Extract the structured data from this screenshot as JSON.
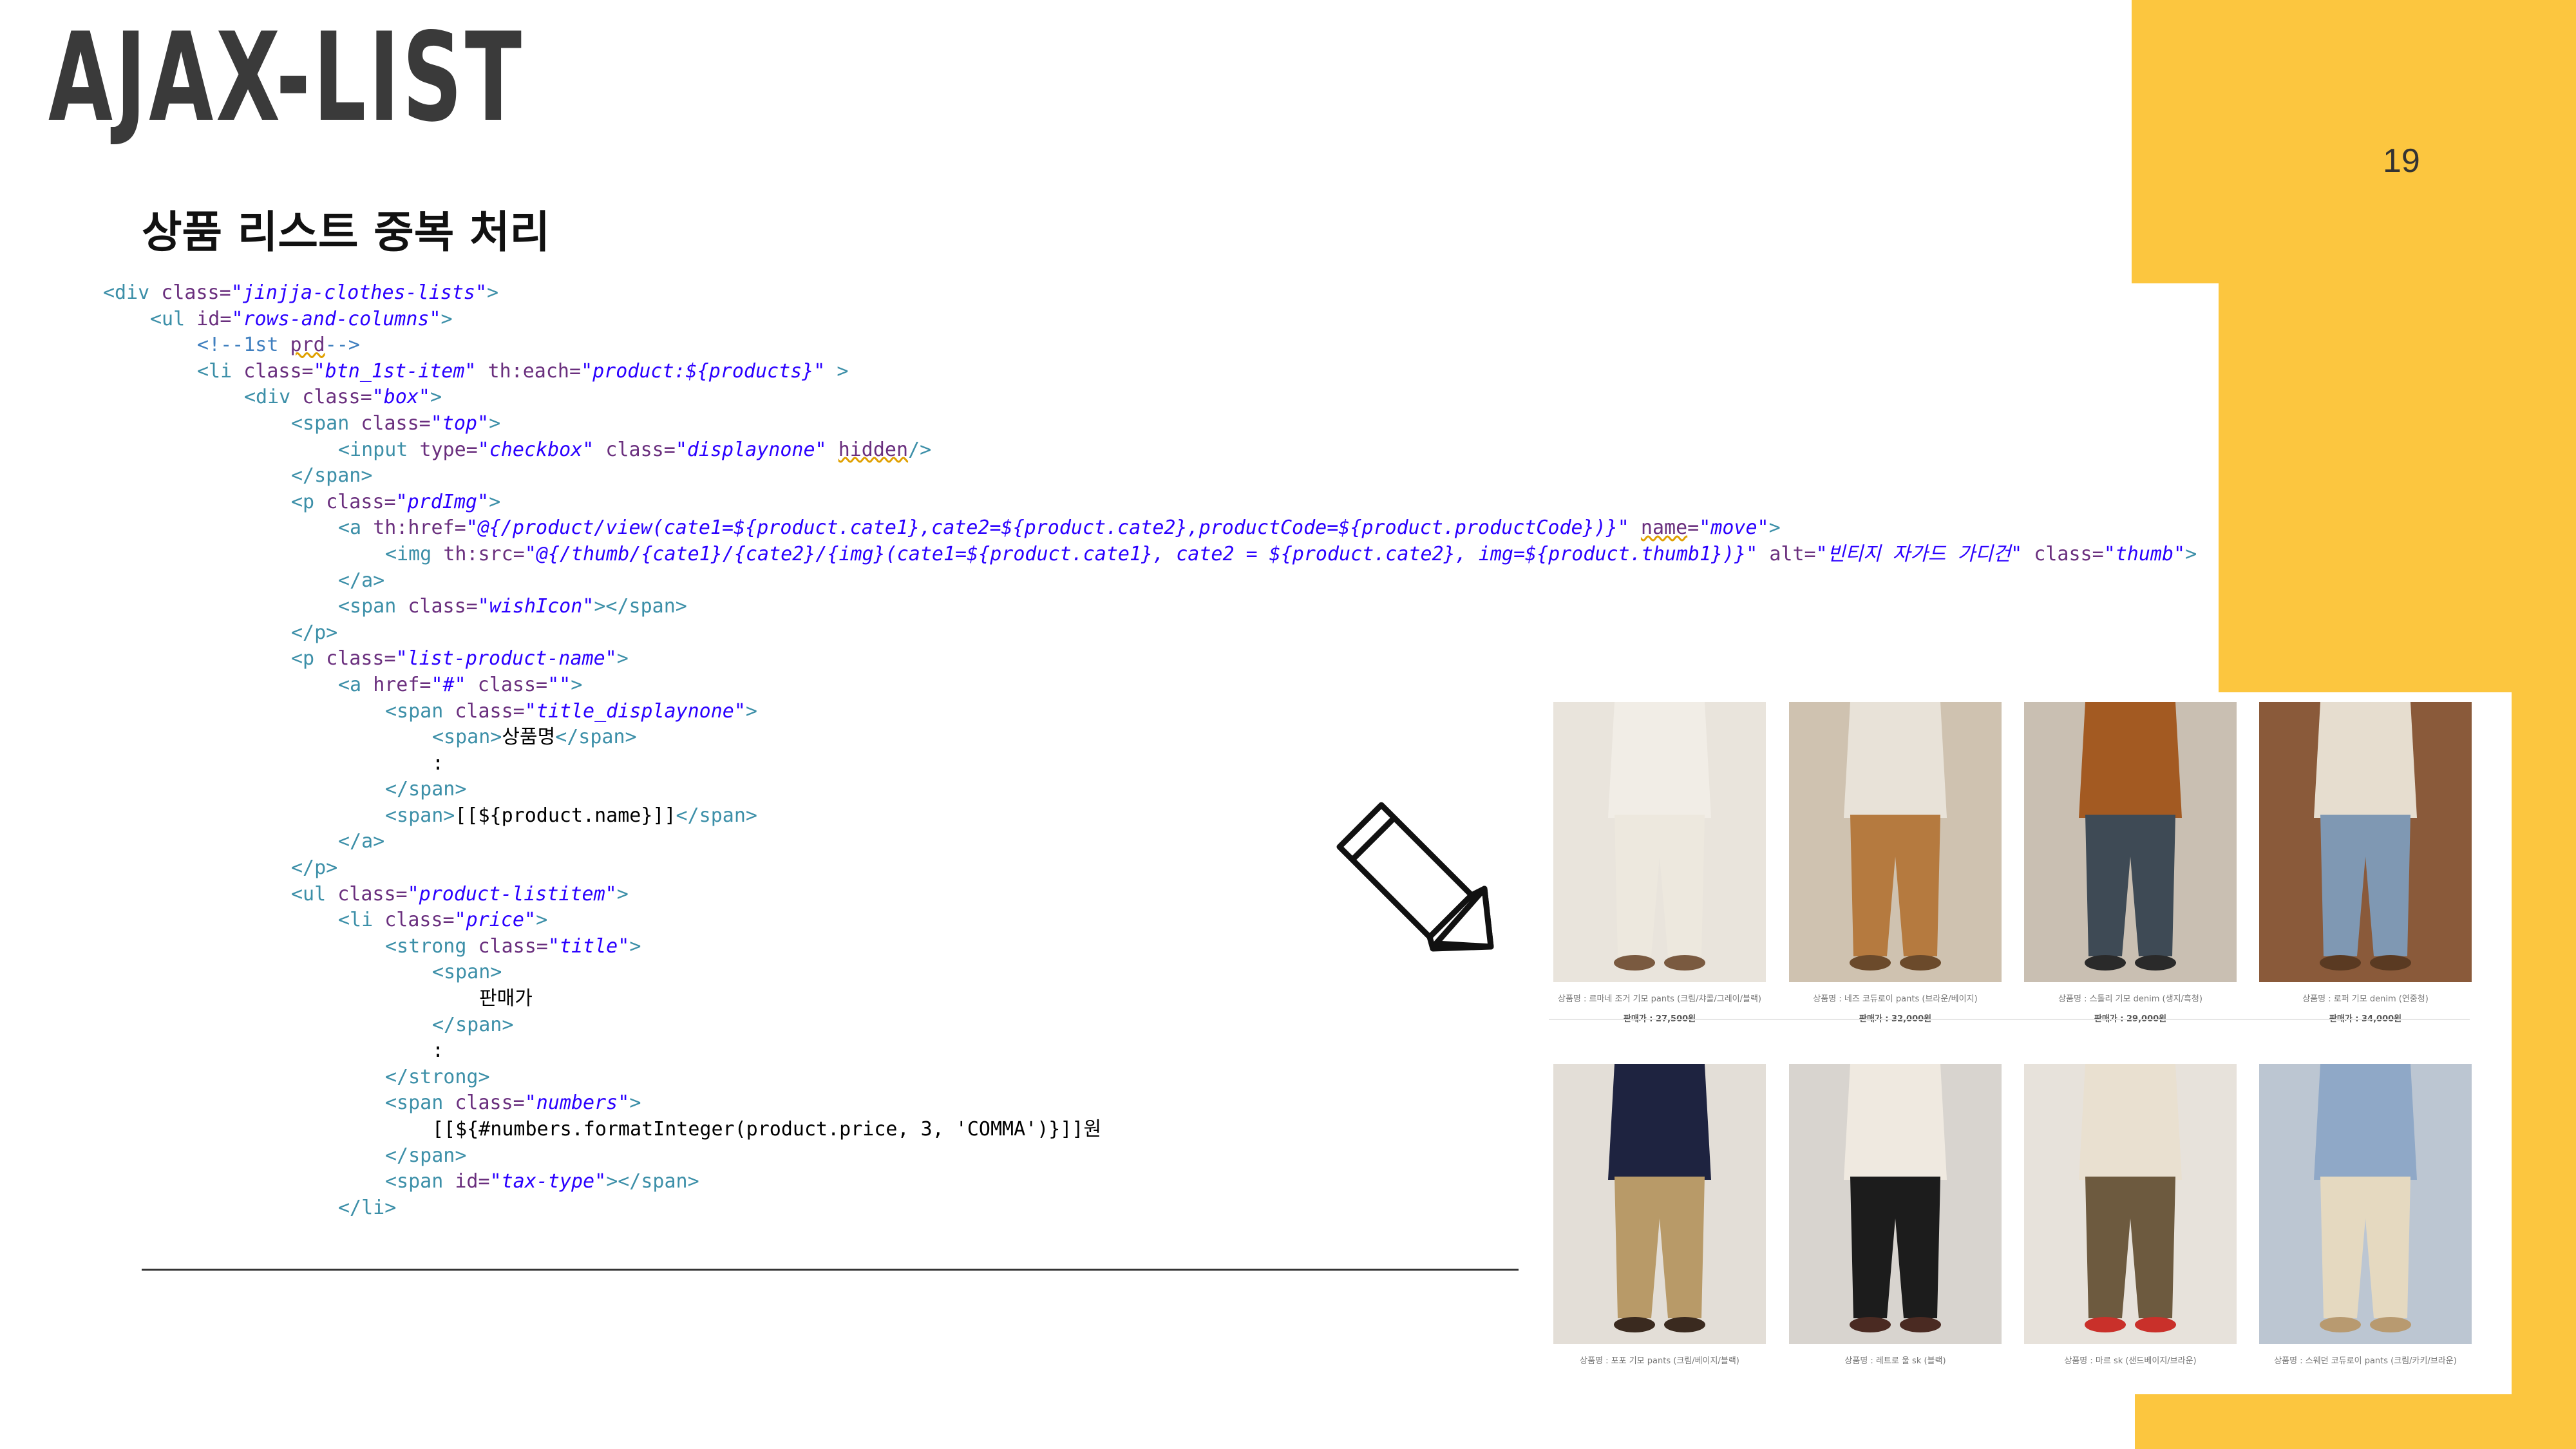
{
  "slide": {
    "title": "AJAX-LIST",
    "page_number": "19",
    "heading": "상품 리스트 중복 처리"
  },
  "colors": {
    "accent": "#fcc63f",
    "title": "#3a3a3a",
    "code_tag": "#3c8fa8",
    "code_attr": "#6a2f7e",
    "code_value": "#2a00ff"
  },
  "code_lines": [
    {
      "indent": 0,
      "tokens": [
        [
          "t",
          "<div "
        ],
        [
          "a",
          "class="
        ],
        [
          "v",
          "\"jinjja-clothes-lists\""
        ],
        [
          "t",
          ">"
        ]
      ]
    },
    {
      "indent": 1,
      "tokens": [
        [
          "t",
          "<ul "
        ],
        [
          "a",
          "id="
        ],
        [
          "v",
          "\"rows-and-columns\""
        ],
        [
          "t",
          ">"
        ]
      ]
    },
    {
      "indent": 2,
      "tokens": [
        [
          "c",
          "<!--1st "
        ],
        [
          "w",
          "prd"
        ],
        [
          "c",
          "-->"
        ]
      ]
    },
    {
      "indent": 2,
      "tokens": [
        [
          "t",
          "<li "
        ],
        [
          "a",
          "class="
        ],
        [
          "v",
          "\"btn_1st-item\""
        ],
        [
          "a",
          " th:each="
        ],
        [
          "v",
          "\"product:${products}\""
        ],
        [
          "t",
          " >"
        ]
      ]
    },
    {
      "indent": 3,
      "tokens": [
        [
          "t",
          "<div "
        ],
        [
          "a",
          "class="
        ],
        [
          "v",
          "\"box\""
        ],
        [
          "t",
          ">"
        ]
      ]
    },
    {
      "indent": 4,
      "tokens": [
        [
          "t",
          "<span "
        ],
        [
          "a",
          "class="
        ],
        [
          "v",
          "\"top\""
        ],
        [
          "t",
          ">"
        ]
      ]
    },
    {
      "indent": 5,
      "tokens": [
        [
          "t",
          "<input "
        ],
        [
          "a",
          "type="
        ],
        [
          "v",
          "\"checkbox\""
        ],
        [
          "a",
          " class="
        ],
        [
          "v",
          "\"displaynone\""
        ],
        [
          "t",
          " "
        ],
        [
          "w",
          "hidden"
        ],
        [
          "t",
          "/>"
        ]
      ]
    },
    {
      "indent": 4,
      "tokens": [
        [
          "t",
          "</span>"
        ]
      ]
    },
    {
      "indent": 4,
      "tokens": [
        [
          "t",
          "<p "
        ],
        [
          "a",
          "class="
        ],
        [
          "v",
          "\"prdImg\""
        ],
        [
          "t",
          ">"
        ]
      ]
    },
    {
      "indent": 5,
      "tokens": [
        [
          "t",
          "<a "
        ],
        [
          "a",
          "th:href="
        ],
        [
          "v",
          "\"@{/product/view(cate1=${product.cate1},cate2=${product.cate2},productCode=${product.productCode})}\""
        ],
        [
          "t",
          " "
        ],
        [
          "w",
          "name"
        ],
        [
          "a",
          "="
        ],
        [
          "v",
          "\"move\""
        ],
        [
          "t",
          ">"
        ]
      ]
    },
    {
      "indent": 6,
      "tokens": [
        [
          "t",
          "<img "
        ],
        [
          "a",
          "th:src="
        ],
        [
          "v",
          "\"@{/thumb/{cate1}/{cate2}/{img}(cate1=${product.cate1}, cate2 = ${product.cate2}, img=${product.thumb1})}\""
        ],
        [
          "a",
          " alt="
        ],
        [
          "v",
          "\"빈티지 자가드 가디건\""
        ],
        [
          "a",
          " class="
        ],
        [
          "v",
          "\"thumb\""
        ],
        [
          "t",
          ">"
        ]
      ]
    },
    {
      "indent": 5,
      "tokens": [
        [
          "t",
          "</a>"
        ]
      ]
    },
    {
      "indent": 5,
      "tokens": [
        [
          "t",
          "<span "
        ],
        [
          "a",
          "class="
        ],
        [
          "v",
          "\"wishIcon\""
        ],
        [
          "t",
          "></span>"
        ]
      ]
    },
    {
      "indent": 4,
      "tokens": [
        [
          "t",
          "</p>"
        ]
      ]
    },
    {
      "indent": 4,
      "tokens": [
        [
          "t",
          "<p "
        ],
        [
          "a",
          "class="
        ],
        [
          "v",
          "\"list-product-name\""
        ],
        [
          "t",
          ">"
        ]
      ]
    },
    {
      "indent": 5,
      "tokens": [
        [
          "t",
          "<a "
        ],
        [
          "a",
          "href="
        ],
        [
          "v",
          "\"#\""
        ],
        [
          "a",
          " class="
        ],
        [
          "v",
          "\"\""
        ],
        [
          "t",
          ">"
        ]
      ]
    },
    {
      "indent": 6,
      "tokens": [
        [
          "t",
          "<span "
        ],
        [
          "a",
          "class="
        ],
        [
          "v",
          "\"title_displaynone\""
        ],
        [
          "t",
          ">"
        ]
      ]
    },
    {
      "indent": 7,
      "tokens": [
        [
          "t",
          "<span>"
        ],
        [
          "x",
          "상품명"
        ],
        [
          "t",
          "</span>"
        ]
      ]
    },
    {
      "indent": 7,
      "tokens": [
        [
          "x",
          ":"
        ]
      ]
    },
    {
      "indent": 6,
      "tokens": [
        [
          "t",
          "</span>"
        ]
      ]
    },
    {
      "indent": 6,
      "tokens": [
        [
          "t",
          "<span>"
        ],
        [
          "x",
          "[[${product.name}]]"
        ],
        [
          "t",
          "</span>"
        ]
      ]
    },
    {
      "indent": 5,
      "tokens": [
        [
          "t",
          "</a>"
        ]
      ]
    },
    {
      "indent": 4,
      "tokens": [
        [
          "t",
          "</p>"
        ]
      ]
    },
    {
      "indent": 4,
      "tokens": [
        [
          "t",
          "<ul "
        ],
        [
          "a",
          "class="
        ],
        [
          "v",
          "\"product-listitem\""
        ],
        [
          "t",
          ">"
        ]
      ]
    },
    {
      "indent": 5,
      "tokens": [
        [
          "t",
          "<li "
        ],
        [
          "a",
          "class="
        ],
        [
          "v",
          "\"price\""
        ],
        [
          "t",
          ">"
        ]
      ]
    },
    {
      "indent": 6,
      "tokens": [
        [
          "t",
          "<strong "
        ],
        [
          "a",
          "class="
        ],
        [
          "v",
          "\"title\""
        ],
        [
          "t",
          ">"
        ]
      ]
    },
    {
      "indent": 7,
      "tokens": [
        [
          "t",
          "<span>"
        ]
      ]
    },
    {
      "indent": 8,
      "tokens": [
        [
          "x",
          "판매가"
        ]
      ]
    },
    {
      "indent": 7,
      "tokens": [
        [
          "t",
          "</span>"
        ]
      ]
    },
    {
      "indent": 7,
      "tokens": [
        [
          "x",
          ":"
        ]
      ]
    },
    {
      "indent": 6,
      "tokens": [
        [
          "t",
          "</strong>"
        ]
      ]
    },
    {
      "indent": 6,
      "tokens": [
        [
          "t",
          "<span "
        ],
        [
          "a",
          "class="
        ],
        [
          "v",
          "\"numbers\""
        ],
        [
          "t",
          ">"
        ]
      ]
    },
    {
      "indent": 7,
      "tokens": [
        [
          "x",
          "[[${#numbers.formatInteger(product.price, 3, 'COMMA')}]]원"
        ]
      ]
    },
    {
      "indent": 6,
      "tokens": [
        [
          "t",
          "</span>"
        ]
      ]
    },
    {
      "indent": 6,
      "tokens": [
        [
          "t",
          "<span "
        ],
        [
          "a",
          "id="
        ],
        [
          "v",
          "\"tax-type\""
        ],
        [
          "t",
          "></span>"
        ]
      ]
    },
    {
      "indent": 5,
      "tokens": [
        [
          "t",
          "</li>"
        ]
      ]
    }
  ],
  "products": [
    {
      "name": "상품명 : 르마네 조거 기모 pants (크림/챠콜/그레이/블랙)",
      "price": "판매가 : 27,500원",
      "colors": {
        "bg": "#e9e4dc",
        "top": "#f1ede6",
        "bottom": "#ede8de",
        "accent": "#7a5a40"
      }
    },
    {
      "name": "상품명 : 네즈 코듀로이 pants (브라운/베이지)",
      "price": "판매가 : 32,000원",
      "colors": {
        "bg": "#cfc2b0",
        "top": "#e8e2d8",
        "bottom": "#b57a3f",
        "accent": "#6b4a2b"
      }
    },
    {
      "name": "상품명 : 스톨리 기모 denim (생지/흑청)",
      "price": "판매가 : 29,000원",
      "colors": {
        "bg": "#c9bfb2",
        "top": "#a35a22",
        "bottom": "#3e4a55",
        "accent": "#2a2a2a"
      }
    },
    {
      "name": "상품명 : 로퍼 기모 denim (연중청)",
      "price": "판매가 : 34,000원",
      "colors": {
        "bg": "#8a5a3a",
        "top": "#e6ddcf",
        "bottom": "#7f98b3",
        "accent": "#5a3a22"
      }
    },
    {
      "name": "상품명 : 포포 기모 pants (크림/베이지/블랙)",
      "price": "",
      "colors": {
        "bg": "#e3ded7",
        "top": "#1e2340",
        "bottom": "#b89a68",
        "accent": "#3a2a1f"
      }
    },
    {
      "name": "상품명 : 레트로 울 sk (블랙)",
      "price": "",
      "colors": {
        "bg": "#d8d4cf",
        "top": "#efe9e0",
        "bottom": "#1c1c1c",
        "accent": "#4a2a22"
      }
    },
    {
      "name": "상품명 : 마르 sk (샌드베이지/브라운)",
      "price": "",
      "colors": {
        "bg": "#e7e2db",
        "top": "#e9e0d0",
        "bottom": "#6d5a3f",
        "accent": "#c9302a"
      }
    },
    {
      "name": "상품명 : 스웨던 코듀로이 pants (크림/카키/브라운)",
      "price": "",
      "colors": {
        "bg": "#bcc6d2",
        "top": "#8fa8c7",
        "bottom": "#e5d9c0",
        "accent": "#b89a70"
      }
    }
  ]
}
